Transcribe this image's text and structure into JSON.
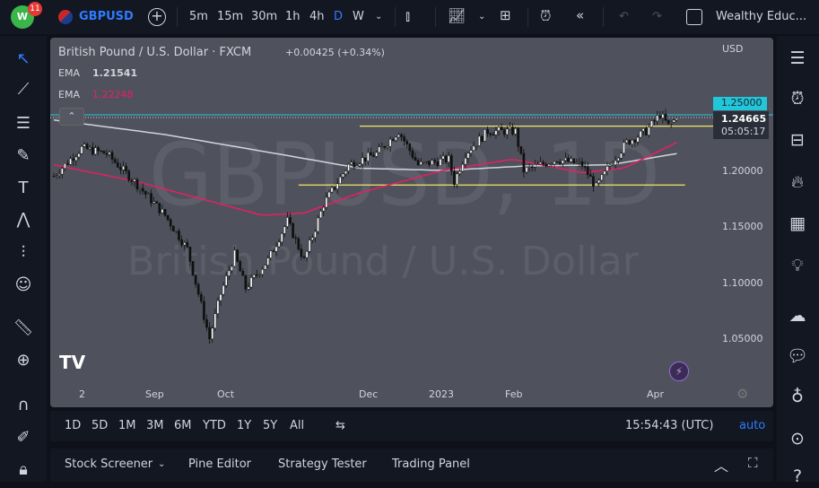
{
  "topbar": {
    "badge": "11",
    "symbol": "GBPUSD",
    "intervals": [
      "5m",
      "15m",
      "30m",
      "1h",
      "4h",
      "D",
      "W"
    ],
    "active_interval": "D",
    "layout_name": "Wealthy Educ..."
  },
  "legend": {
    "title": "British Pound / U.S. Dollar · FXCM",
    "change": "+0.00425 (+0.34%)",
    "ema1_label": "EMA",
    "ema1_value": "1.21541",
    "ema2_label": "EMA",
    "ema2_value": "1.22248"
  },
  "watermark": {
    "line1": "GBPUSD, 1D",
    "line2": "British Pound / U.S. Dollar"
  },
  "price_axis": {
    "currency": "USD",
    "ticks": [
      "1.25000",
      "1.20000",
      "1.15000",
      "1.10000",
      "1.05000"
    ],
    "alert_price": "1.25000",
    "last_price": "1.24665",
    "countdown": "05:05:17"
  },
  "time_axis": [
    "2",
    "Sep",
    "Oct",
    "Dec",
    "2023",
    "Feb",
    "Apr"
  ],
  "timeframes": {
    "ranges": [
      "1D",
      "5D",
      "1M",
      "3M",
      "6M",
      "YTD",
      "1Y",
      "5Y",
      "All"
    ],
    "clock": "15:54:43 (UTC)",
    "auto": "auto"
  },
  "bottom_panel": {
    "tabs": [
      "Stock Screener",
      "Pine Editor",
      "Strategy Tester",
      "Trading Panel"
    ]
  },
  "colors": {
    "accent": "#2962ff",
    "ema200": "#d1d4dc",
    "ema50": "#e91e63",
    "support": "#f5e663",
    "alert": "#22c6da",
    "chart_bg": "#4f525c"
  },
  "chart_data": {
    "type": "candlestick",
    "symbol": "GBPUSD",
    "timeframe": "1D",
    "ylim": [
      1.02,
      1.28
    ],
    "close_keypoints": [
      [
        0,
        1.195
      ],
      [
        10,
        1.22
      ],
      [
        19,
        1.215
      ],
      [
        29,
        1.19
      ],
      [
        40,
        1.16
      ],
      [
        48,
        1.13
      ],
      [
        56,
        1.05
      ],
      [
        60,
        1.09
      ],
      [
        65,
        1.125
      ],
      [
        69,
        1.095
      ],
      [
        77,
        1.12
      ],
      [
        84,
        1.155
      ],
      [
        90,
        1.12
      ],
      [
        97,
        1.17
      ],
      [
        106,
        1.205
      ],
      [
        116,
        1.215
      ],
      [
        124,
        1.235
      ],
      [
        131,
        1.205
      ],
      [
        142,
        1.21
      ],
      [
        144,
        1.19
      ],
      [
        148,
        1.215
      ],
      [
        156,
        1.235
      ],
      [
        166,
        1.235
      ],
      [
        169,
        1.2
      ],
      [
        181,
        1.21
      ],
      [
        190,
        1.205
      ],
      [
        195,
        1.185
      ],
      [
        200,
        1.205
      ],
      [
        206,
        1.225
      ],
      [
        213,
        1.235
      ],
      [
        218,
        1.25
      ],
      [
        221,
        1.24
      ],
      [
        224,
        1.2466
      ]
    ],
    "ema200_keypoints": [
      [
        0,
        1.245
      ],
      [
        40,
        1.232
      ],
      [
        80,
        1.215
      ],
      [
        110,
        1.202
      ],
      [
        140,
        1.2
      ],
      [
        170,
        1.204
      ],
      [
        200,
        1.205
      ],
      [
        224,
        1.215
      ]
    ],
    "ema50_keypoints": [
      [
        0,
        1.205
      ],
      [
        30,
        1.19
      ],
      [
        60,
        1.17
      ],
      [
        75,
        1.16
      ],
      [
        90,
        1.162
      ],
      [
        110,
        1.18
      ],
      [
        140,
        1.2
      ],
      [
        165,
        1.21
      ],
      [
        190,
        1.198
      ],
      [
        205,
        1.202
      ],
      [
        224,
        1.225
      ]
    ],
    "levels": [
      {
        "name": "resistance",
        "price": 1.2395,
        "from": 110,
        "to": 240
      },
      {
        "name": "support",
        "price": 1.187,
        "from": 88,
        "to": 227
      }
    ]
  }
}
